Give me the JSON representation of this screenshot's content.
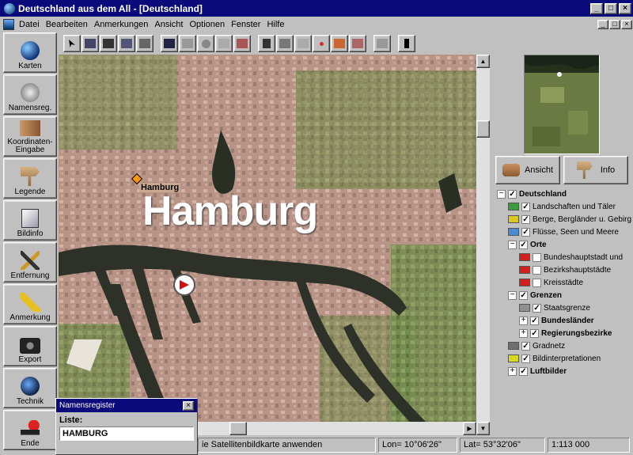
{
  "window": {
    "title": "Deutschland aus dem All - [Deutschland]",
    "minimize": "_",
    "maximize": "□",
    "close": "×"
  },
  "menu": {
    "items": [
      "Datei",
      "Bearbeiten",
      "Anmerkungen",
      "Ansicht",
      "Optionen",
      "Fenster",
      "Hilfe"
    ]
  },
  "leftbar": {
    "buttons": [
      {
        "label": "Karten",
        "icon": "globe-icon"
      },
      {
        "label": "Namensreg.",
        "icon": "names-icon"
      },
      {
        "label": "Koordinaten-Eingabe",
        "icon": "coordinates-icon"
      },
      {
        "label": "Legende",
        "icon": "signpost-icon"
      },
      {
        "label": "Bildinfo",
        "icon": "image-info-icon"
      },
      {
        "label": "Entfernung",
        "icon": "compass-icon"
      },
      {
        "label": "Anmerkung",
        "icon": "pencil-icon"
      },
      {
        "label": "Export",
        "icon": "camera-icon"
      },
      {
        "label": "Technik",
        "icon": "satellite-icon"
      },
      {
        "label": "Ende",
        "icon": "exit-icon"
      }
    ]
  },
  "map": {
    "city_label_big": "Hamburg",
    "city_label_small": "Hamburg"
  },
  "rightpanel": {
    "ansicht_label": "Ansicht",
    "info_label": "Info"
  },
  "tree": [
    {
      "level": 0,
      "expander": "−",
      "checked": true,
      "label": "Deutschland",
      "bold": true
    },
    {
      "level": 1,
      "swatch": "#3c9a3c",
      "checked": true,
      "label": "Landschaften und Täler"
    },
    {
      "level": 1,
      "swatch": "#d8c820",
      "checked": true,
      "label": "Berge, Bergländer u. Gebirge"
    },
    {
      "level": 1,
      "swatch": "#4a8ad0",
      "checked": true,
      "label": "Flüsse, Seen und Meere"
    },
    {
      "level": 1,
      "expander": "−",
      "checked": true,
      "label": "Orte",
      "bold": true
    },
    {
      "level": 2,
      "swatch": "#d02020",
      "checked": false,
      "label": "Bundeshauptstadt und"
    },
    {
      "level": 2,
      "swatch": "#d02020",
      "checked": false,
      "label": "Bezirkshauptstädte"
    },
    {
      "level": 2,
      "swatch": "#d02020",
      "checked": false,
      "label": "Kreisstädte"
    },
    {
      "level": 1,
      "expander": "−",
      "checked": true,
      "label": "Grenzen",
      "bold": true
    },
    {
      "level": 2,
      "swatch": "#909090",
      "checked": true,
      "label": "Staatsgrenze"
    },
    {
      "level": 2,
      "expander": "+",
      "checked": true,
      "label": "Bundesländer",
      "bold": true
    },
    {
      "level": 2,
      "expander": "+",
      "checked": true,
      "label": "Regierungsbezirke",
      "bold": true
    },
    {
      "level": 1,
      "swatch": "#707070",
      "checked": true,
      "label": "Gradnetz"
    },
    {
      "level": 1,
      "swatch": "#d8d820",
      "checked": true,
      "label": "Bildinterpretationen"
    },
    {
      "level": 1,
      "expander": "+",
      "checked": true,
      "label": "Luftbilder",
      "bold": true
    }
  ],
  "status": {
    "message": "ie Satellitenbildkarte anwenden",
    "lon": "Lon= 10°06'26\"",
    "lat": "Lat= 53°32'06\"",
    "scale": "1:113 000"
  },
  "registry": {
    "title": "Namensregister",
    "close": "×",
    "list_label": "Liste:",
    "value": "HAMBURG"
  }
}
